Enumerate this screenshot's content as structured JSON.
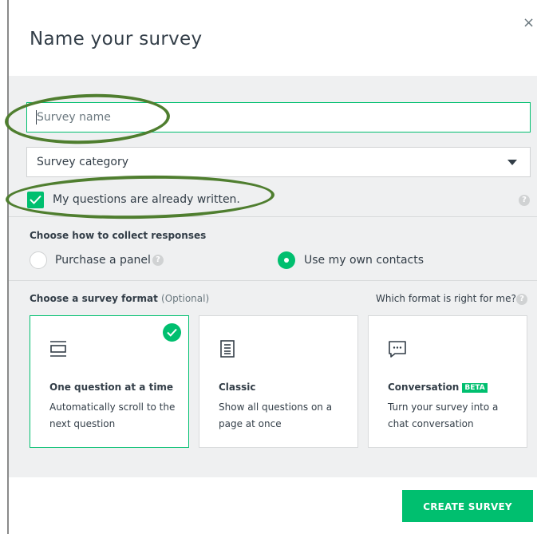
{
  "dialog": {
    "title": "Name your survey",
    "close_symbol": "×"
  },
  "survey_name": {
    "placeholder": "Survey name",
    "value": ""
  },
  "survey_category": {
    "label": "Survey category"
  },
  "already_written": {
    "label": "My questions are already written.",
    "checked": true
  },
  "help_symbol": "?",
  "collect": {
    "heading": "Choose how to collect responses",
    "options": [
      {
        "label": "Purchase a panel",
        "selected": false
      },
      {
        "label": "Use my own contacts",
        "selected": true
      }
    ]
  },
  "format": {
    "heading": "Choose a survey format",
    "optional": "(Optional)",
    "which_link": "Which format is right for me?",
    "cards": [
      {
        "title": "One question at a time",
        "description": "Automatically scroll to the next question",
        "selected": true,
        "icon": "one-question-icon"
      },
      {
        "title": "Classic",
        "description": "Show all questions on a page at once",
        "selected": false,
        "icon": "list-icon"
      },
      {
        "title": "Conversation",
        "badge": "BETA",
        "description": "Turn your survey into a chat conversation",
        "selected": false,
        "icon": "chat-icon"
      }
    ]
  },
  "create_button": {
    "label": "CREATE SURVEY"
  },
  "colors": {
    "accent": "#00bf6f",
    "annotation": "#4f7e2f",
    "panel": "#eff0f1",
    "text": "#333e48"
  }
}
